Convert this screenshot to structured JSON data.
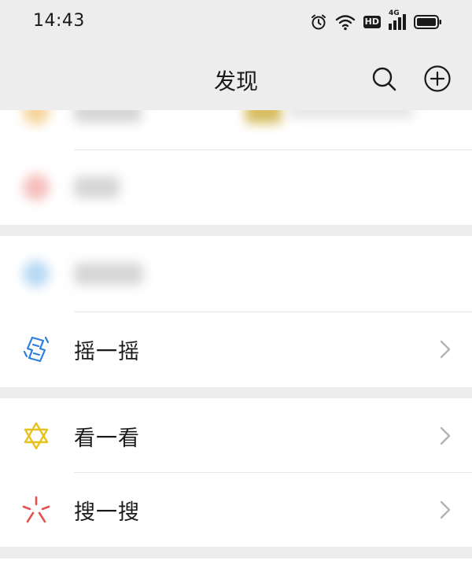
{
  "status_bar": {
    "time": "14:43",
    "icons": [
      "alarm-icon",
      "wifi-icon",
      "hd-icon",
      "signal-4g-icon",
      "battery-icon"
    ],
    "hd_label": "HD",
    "network_label": "4G"
  },
  "nav": {
    "title": "发现",
    "search_icon": "search-icon",
    "add_icon": "add-circle-icon"
  },
  "menu": {
    "shake": {
      "label": "摇一摇",
      "icon": "shake-icon",
      "icon_color": "#2a7de1"
    },
    "top_stories": {
      "label": "看一看",
      "icon": "top-stories-icon",
      "icon_color": "#e8c21c"
    },
    "search": {
      "label": "搜一搜",
      "icon": "search-sparkle-icon",
      "icon_color": "#e5524c"
    }
  },
  "colors": {
    "background": "#ededed",
    "card": "#ffffff",
    "text": "#1a1a1a",
    "chevron": "#b3b3b3"
  }
}
